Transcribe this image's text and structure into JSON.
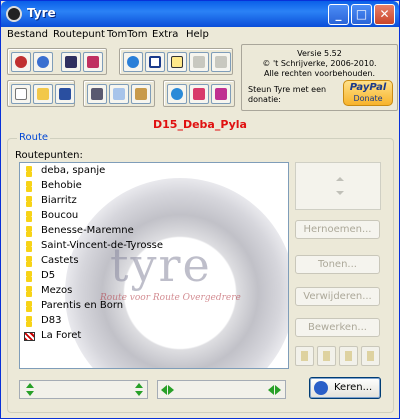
{
  "window": {
    "title": "Tyre",
    "minimize_label": "_",
    "maximize_label": "□",
    "close_label": "✕"
  },
  "menu": [
    "Bestand",
    "Routepunt",
    "TomTom",
    "Extra",
    "Help"
  ],
  "about": {
    "version": "Versie 5.52",
    "copyright": "© 't Schrijverke, 2006-2010.",
    "rights": "Alle rechten voorbehouden.",
    "donate_text": "Steun Tyre met een donatie:",
    "paypal_logo": "PayPal",
    "paypal_donate": "Donate"
  },
  "toolbar": {
    "icons": [
      "gps-icon",
      "globe-icon",
      "binoculars-icon",
      "bookmark-icon",
      "internet-globe-icon",
      "window-icon",
      "help-icon",
      "undo-icon",
      "redo-icon",
      "new-file-icon",
      "open-folder-icon",
      "save-icon",
      "cut-icon",
      "copy-icon",
      "paste-icon",
      "sync-icon",
      "send-icon",
      "pin-icon"
    ]
  },
  "route_name": "D15_Deba_Pyla",
  "route_group": {
    "legend": "Route",
    "points_label": "Routepunten:",
    "points": [
      {
        "label": "deba, spanje",
        "type": "waypoint"
      },
      {
        "label": "Behobie",
        "type": "waypoint"
      },
      {
        "label": "Biarritz",
        "type": "waypoint"
      },
      {
        "label": "Boucou",
        "type": "waypoint"
      },
      {
        "label": "Benesse-Maremne",
        "type": "waypoint"
      },
      {
        "label": "Saint-Vincent-de-Tyrosse",
        "type": "waypoint"
      },
      {
        "label": "Castets",
        "type": "waypoint"
      },
      {
        "label": "D5",
        "type": "waypoint"
      },
      {
        "label": "Mezos",
        "type": "waypoint"
      },
      {
        "label": "Parentis en Born",
        "type": "waypoint"
      },
      {
        "label": "D83",
        "type": "waypoint"
      },
      {
        "label": "La Foret",
        "type": "finish"
      }
    ],
    "watermark": "tyre",
    "watermark_sub": "Route voor Route Overgedrere"
  },
  "buttons": {
    "rename": "Hernoemen...",
    "show": "Tonen...",
    "delete": "Verwijderen...",
    "edit": "Bewerken...",
    "back": "Keren..."
  },
  "colors": {
    "accent_blue": "#0046d5",
    "route_name_red": "#e01010",
    "arrow_green": "#28a028"
  }
}
